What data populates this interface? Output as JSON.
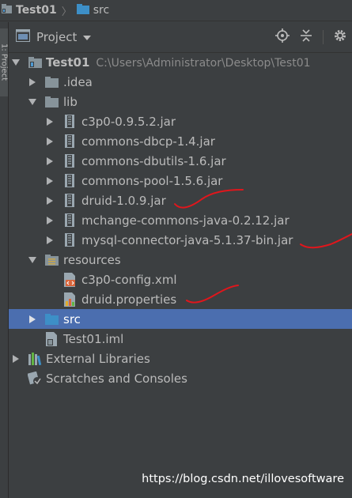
{
  "breadcrumb": {
    "project": "Test01",
    "folder": "src"
  },
  "side_strip": {
    "label": "1: Project"
  },
  "toolbar": {
    "title": "Project"
  },
  "tree": [
    {
      "name": "Test01",
      "path": "C:\\Users\\Administrator\\Desktop\\Test01",
      "icon": "module-folder-icon",
      "expanded": true,
      "bold": true
    },
    {
      "name": ".idea",
      "icon": "folder-icon",
      "expanded": false
    },
    {
      "name": "lib",
      "icon": "folder-icon",
      "expanded": true
    },
    {
      "name": "c3p0-0.9.5.2.jar",
      "icon": "jar-icon",
      "expanded": false
    },
    {
      "name": "commons-dbcp-1.4.jar",
      "icon": "jar-icon",
      "expanded": false
    },
    {
      "name": "commons-dbutils-1.6.jar",
      "icon": "jar-icon",
      "expanded": false
    },
    {
      "name": "commons-pool-1.5.6.jar",
      "icon": "jar-icon",
      "expanded": false
    },
    {
      "name": "druid-1.0.9.jar",
      "icon": "jar-icon",
      "expanded": false
    },
    {
      "name": "mchange-commons-java-0.2.12.jar",
      "icon": "jar-icon",
      "expanded": false
    },
    {
      "name": "mysql-connector-java-5.1.37-bin.jar",
      "icon": "jar-icon",
      "expanded": false
    },
    {
      "name": "resources",
      "icon": "resources-folder-icon",
      "expanded": true
    },
    {
      "name": "c3p0-config.xml",
      "icon": "xml-file-icon"
    },
    {
      "name": "druid.properties",
      "icon": "properties-file-icon"
    },
    {
      "name": "src",
      "icon": "source-folder-icon",
      "expanded": false,
      "selected": true
    },
    {
      "name": "Test01.iml",
      "icon": "iml-file-icon"
    },
    {
      "name": "External Libraries",
      "icon": "libraries-icon",
      "expanded": false
    },
    {
      "name": "Scratches and Consoles",
      "icon": "scratches-icon"
    }
  ],
  "watermark": "https://blog.csdn.net/illovesoftware",
  "colors": {
    "background": "#3c3f41",
    "selection": "#4b6eaf",
    "folder": "#87939a",
    "source_folder": "#3d8fc7",
    "annotation": "#e0161c"
  }
}
